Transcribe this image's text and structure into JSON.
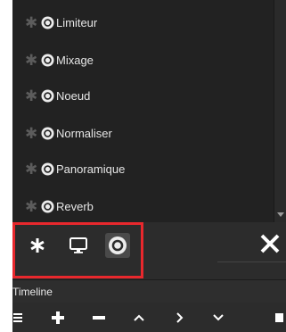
{
  "filters": {
    "items": [
      {
        "label": "Limiteur"
      },
      {
        "label": "Mixage"
      },
      {
        "label": "Noeud"
      },
      {
        "label": "Normaliser"
      },
      {
        "label": "Panoramique"
      },
      {
        "label": "Reverb"
      }
    ]
  },
  "toolbar": {
    "favorites_icon": "asterisk-icon",
    "video_icon": "monitor-icon",
    "audio_icon": "audio-disc-icon",
    "close_icon": "close-icon",
    "highlight_color": "#e8282d"
  },
  "timeline": {
    "title": "Timeline",
    "icons": [
      "menu-icon",
      "plus-icon",
      "minus-icon",
      "chevron-up-icon",
      "chevron-right-icon",
      "chevron-down-icon",
      "square-icon"
    ]
  },
  "colors": {
    "panel_bg": "#2c2c2c",
    "list_bg": "#222222",
    "text": "#e6e6e6"
  }
}
